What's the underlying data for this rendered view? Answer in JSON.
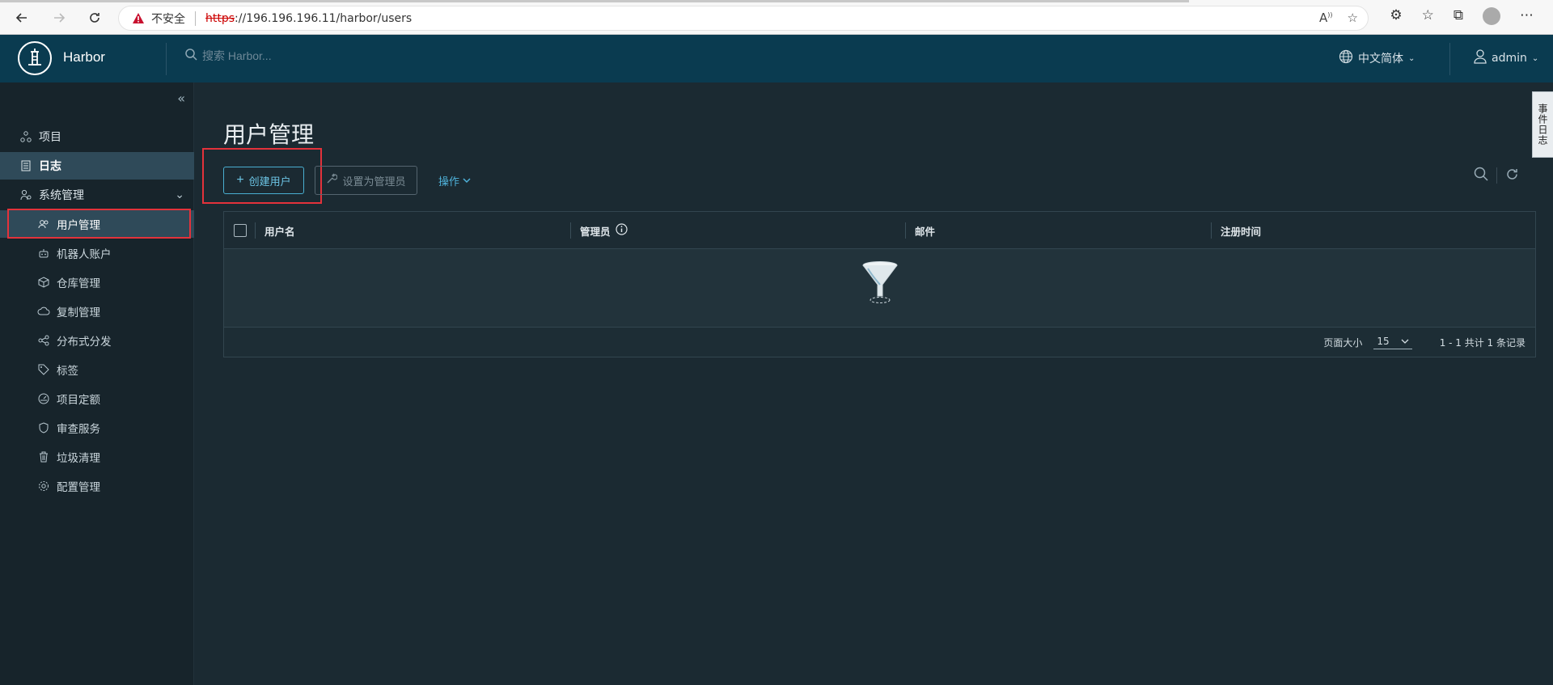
{
  "browser": {
    "insecure_label": "不安全",
    "url_scheme": "https",
    "url_rest": "://196.196.196.11/harbor/users"
  },
  "header": {
    "brand": "Harbor",
    "search_placeholder": "搜索 Harbor...",
    "language": "中文简体",
    "username": "admin"
  },
  "sidebar": {
    "items": [
      {
        "label": "项目",
        "icon": "projects-icon"
      },
      {
        "label": "日志",
        "icon": "logs-icon"
      },
      {
        "label": "系统管理",
        "icon": "admin-icon"
      }
    ],
    "sub_items": [
      {
        "label": "用户管理",
        "icon": "users-icon"
      },
      {
        "label": "机器人账户",
        "icon": "robot-icon"
      },
      {
        "label": "仓库管理",
        "icon": "registry-icon"
      },
      {
        "label": "复制管理",
        "icon": "replication-icon"
      },
      {
        "label": "分布式分发",
        "icon": "share-icon"
      },
      {
        "label": "标签",
        "icon": "tag-icon"
      },
      {
        "label": "项目定额",
        "icon": "quota-icon"
      },
      {
        "label": "审查服务",
        "icon": "shield-icon"
      },
      {
        "label": "垃圾清理",
        "icon": "trash-icon"
      },
      {
        "label": "配置管理",
        "icon": "gear-icon"
      }
    ]
  },
  "main": {
    "title": "用户管理",
    "create_user": "创建用户",
    "set_admin": "设置为管理员",
    "actions": "操作",
    "columns": [
      "用户名",
      "管理员",
      "邮件",
      "注册时间"
    ],
    "page_size_label": "页面大小",
    "page_size": "15",
    "summary": "1 - 1 共计 1 条记录"
  },
  "side_tab": "事件日志",
  "colors": {
    "header_bg": "#0a3b50",
    "accent": "#49aed0",
    "highlight_box": "#e3323b"
  }
}
